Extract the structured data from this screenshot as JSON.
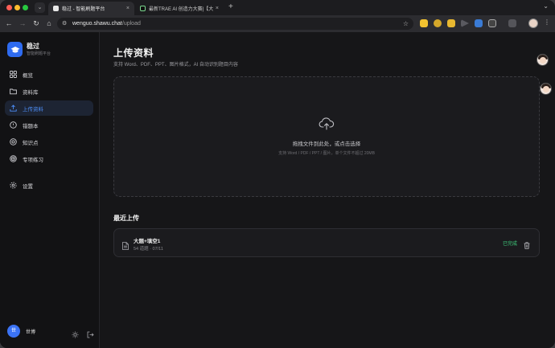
{
  "colors": {
    "accent": "#3b73f5",
    "active_nav_text": "#4d8ef7",
    "success": "#3fcf7e",
    "page_bg": "#161618"
  },
  "browser": {
    "tabs": [
      {
        "title": "稳过 - 智能刷题平台",
        "active": true
      },
      {
        "title": "最新TRAE AI 创造力大赛|【大赛",
        "active": false
      }
    ],
    "url_host": "wenguo.shawu.chat",
    "url_path": "/upload"
  },
  "sidebar": {
    "brand_name": "稳过",
    "brand_sub": "智能刷题平台",
    "items": [
      {
        "label": "概览",
        "icon": "grid-icon"
      },
      {
        "label": "资料库",
        "icon": "folder-icon"
      },
      {
        "label": "上传资料",
        "icon": "upload-icon",
        "active": true
      },
      {
        "label": "错题本",
        "icon": "alert-circle-icon"
      },
      {
        "label": "知识点",
        "icon": "target-icon"
      },
      {
        "label": "专项练习",
        "icon": "crosshair-icon"
      }
    ],
    "settings_label": "设置",
    "user": {
      "name": "世博",
      "avatar_letter": "世"
    }
  },
  "main": {
    "title": "上传资料",
    "subtitle": "支持 Word、PDF、PPT、图片格式，AI 自动识别题目内容",
    "dropzone": {
      "text": "拖拽文件到此处，或点击选择",
      "hint": "支持 Word / PDF / PPT / 图片，单个文件不超过 20MB"
    },
    "recent_title": "最近上传",
    "recent": [
      {
        "title": "大题+填空1",
        "meta": "54 道题 · 07/11",
        "status": "已完成"
      }
    ]
  }
}
